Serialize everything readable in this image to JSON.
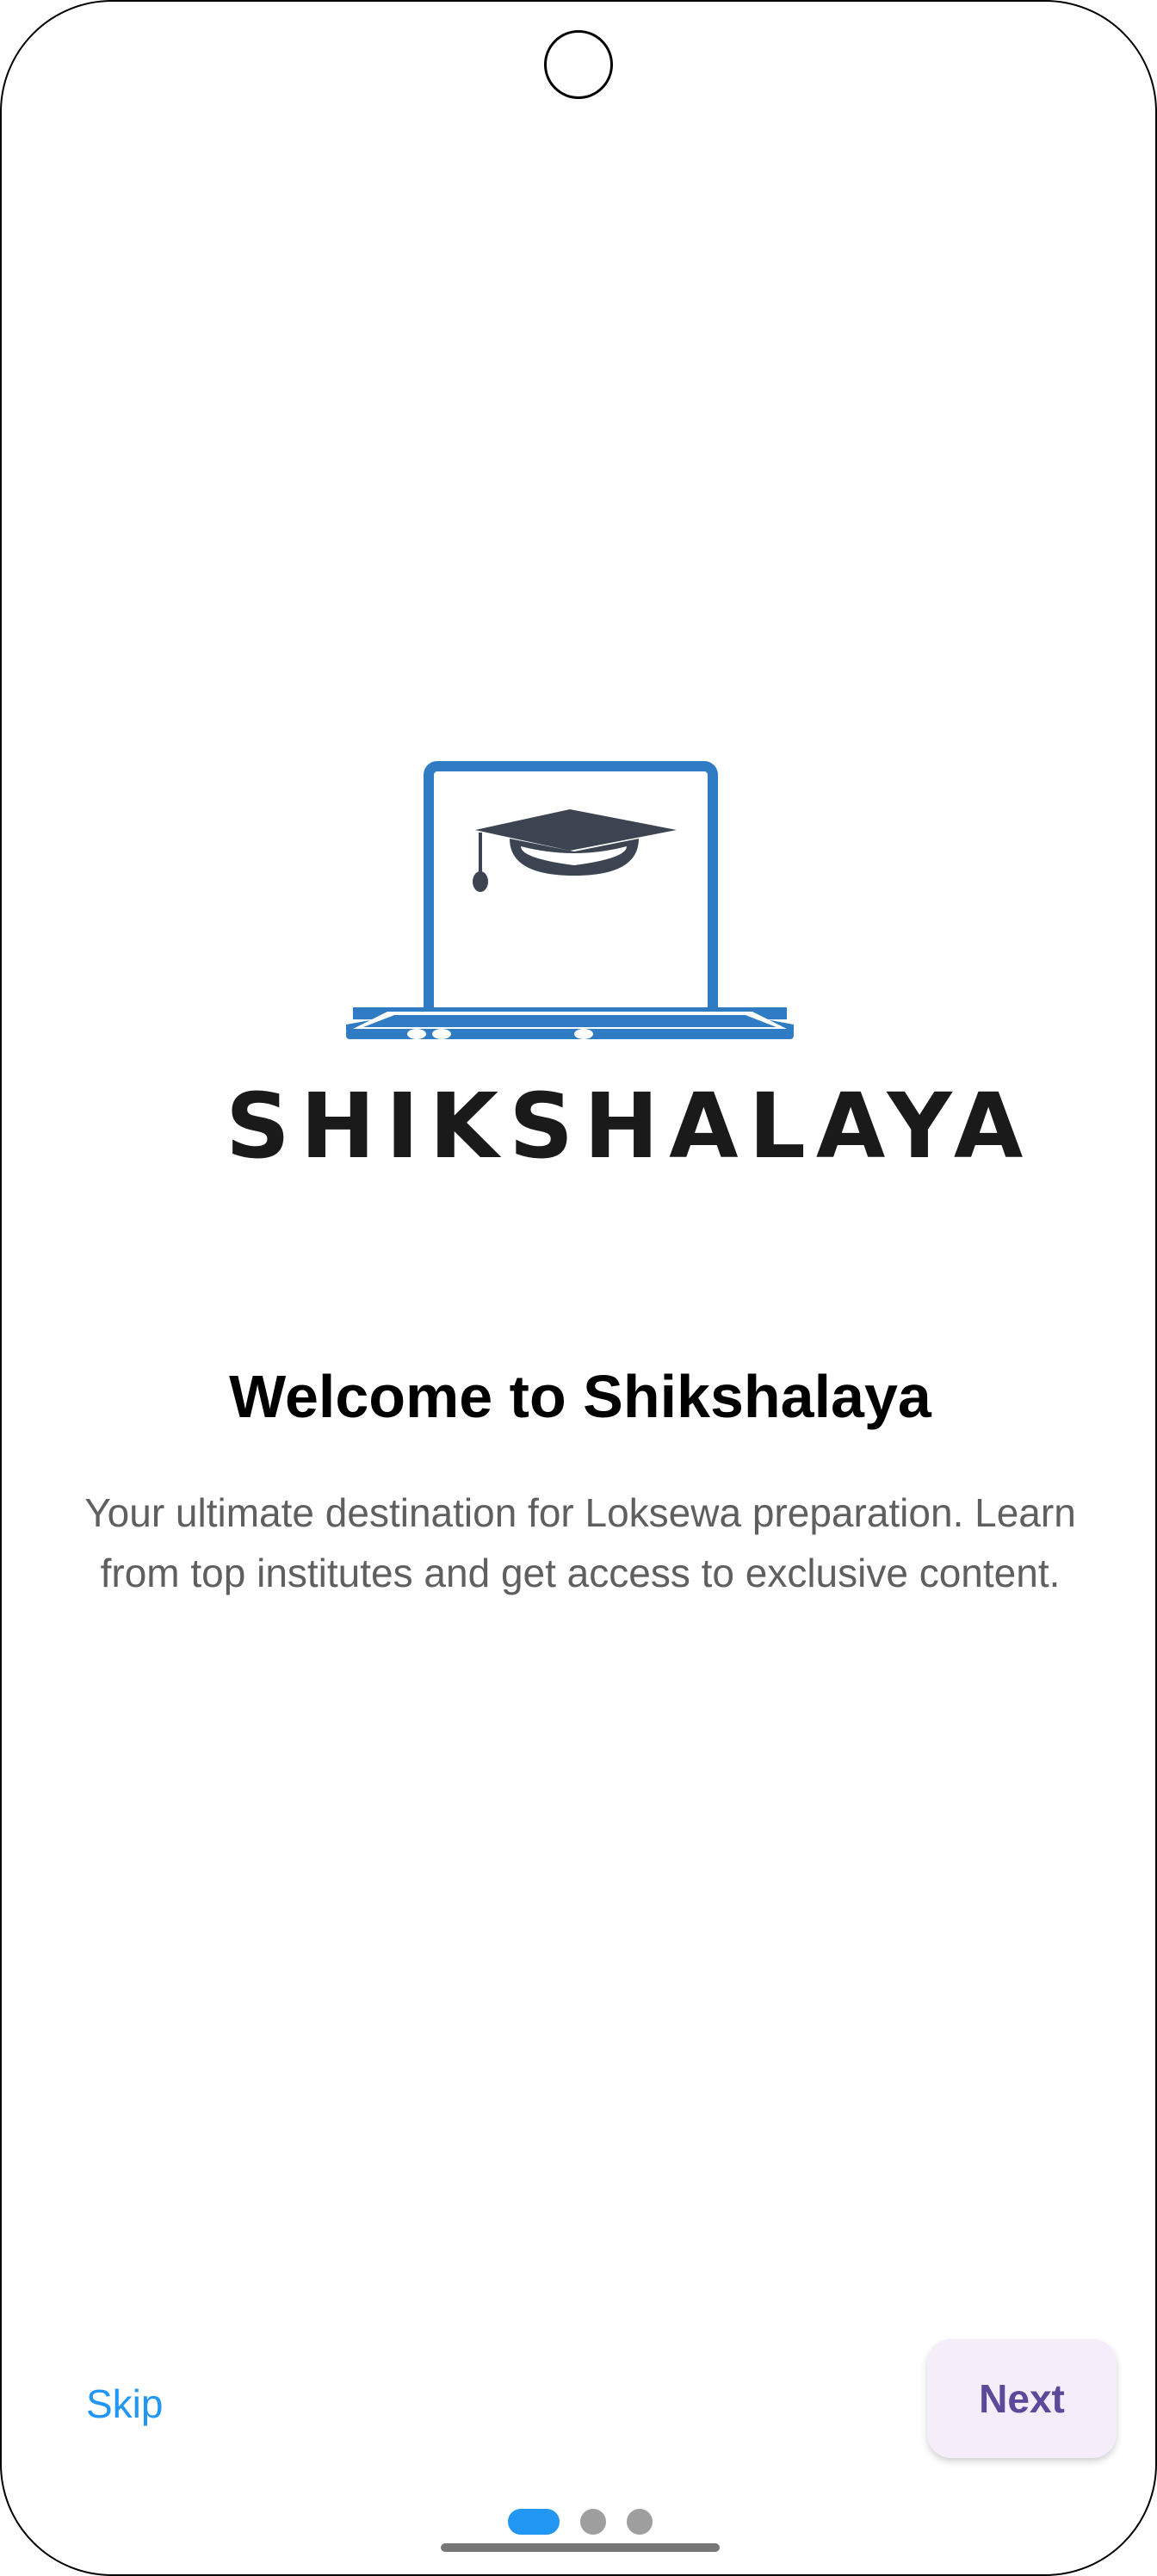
{
  "logo": {
    "wordmark": "SHIKSHALAYA",
    "colors": {
      "laptop": "#2f7bc4",
      "cap": "#3b4450"
    }
  },
  "welcome": {
    "title": "Welcome to Shikshalaya",
    "description": "Your ultimate destination for Loksewa preparation. Learn from top institutes and get access to exclusive content."
  },
  "actions": {
    "skip_label": "Skip",
    "next_label": "Next"
  },
  "pagination": {
    "total_pages": 3,
    "current_page": 1
  },
  "colors": {
    "accent": "#2196f3",
    "next_text": "#5b4a9a",
    "next_background": "#f5eefa",
    "inactive_dot": "#9e9e9e"
  }
}
